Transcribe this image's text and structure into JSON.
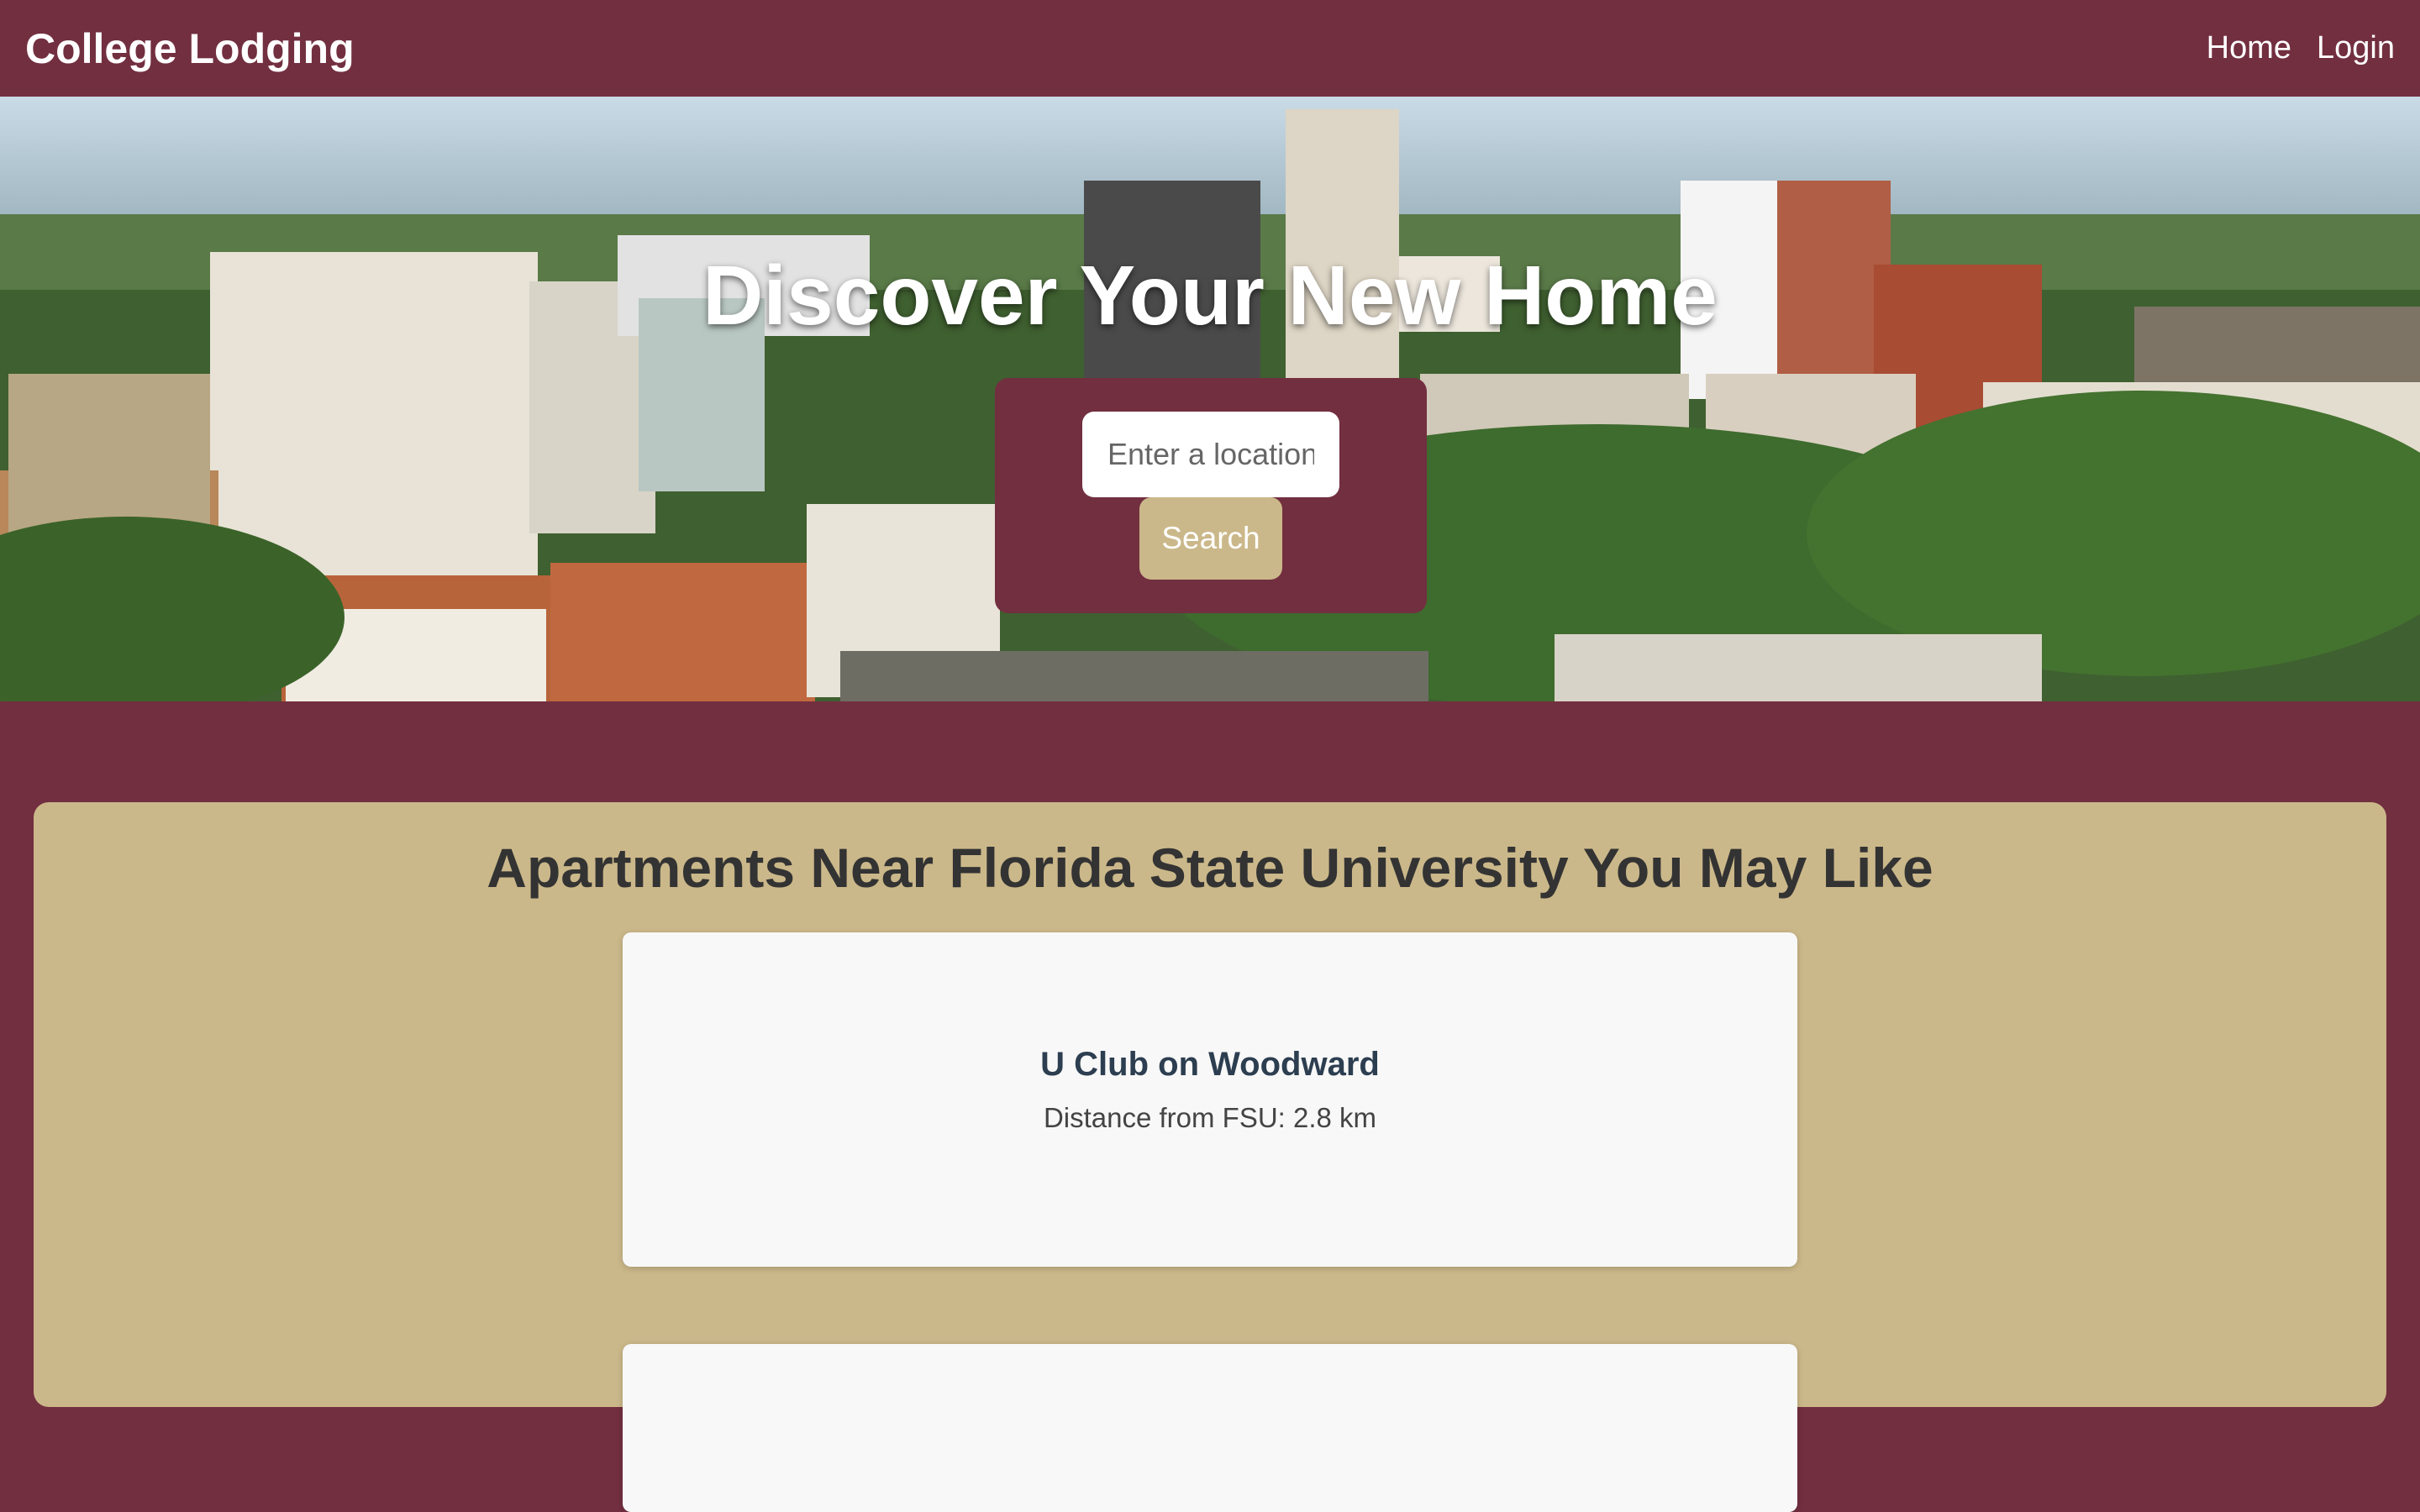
{
  "nav": {
    "brand": "College Lodging",
    "links": [
      {
        "label": "Home"
      },
      {
        "label": "Login"
      }
    ]
  },
  "hero": {
    "title": "Discover Your New Home",
    "search": {
      "placeholder": "Enter a location",
      "button_label": "Search"
    }
  },
  "recommendations": {
    "heading": "Apartments Near Florida State University You May Like",
    "items": [
      {
        "name": "U Club on Woodward",
        "distance": "Distance from FSU: 2.8 km"
      }
    ]
  },
  "colors": {
    "primary": "#722F40",
    "accent": "#CBB88A",
    "card": "#F8F8F8"
  }
}
